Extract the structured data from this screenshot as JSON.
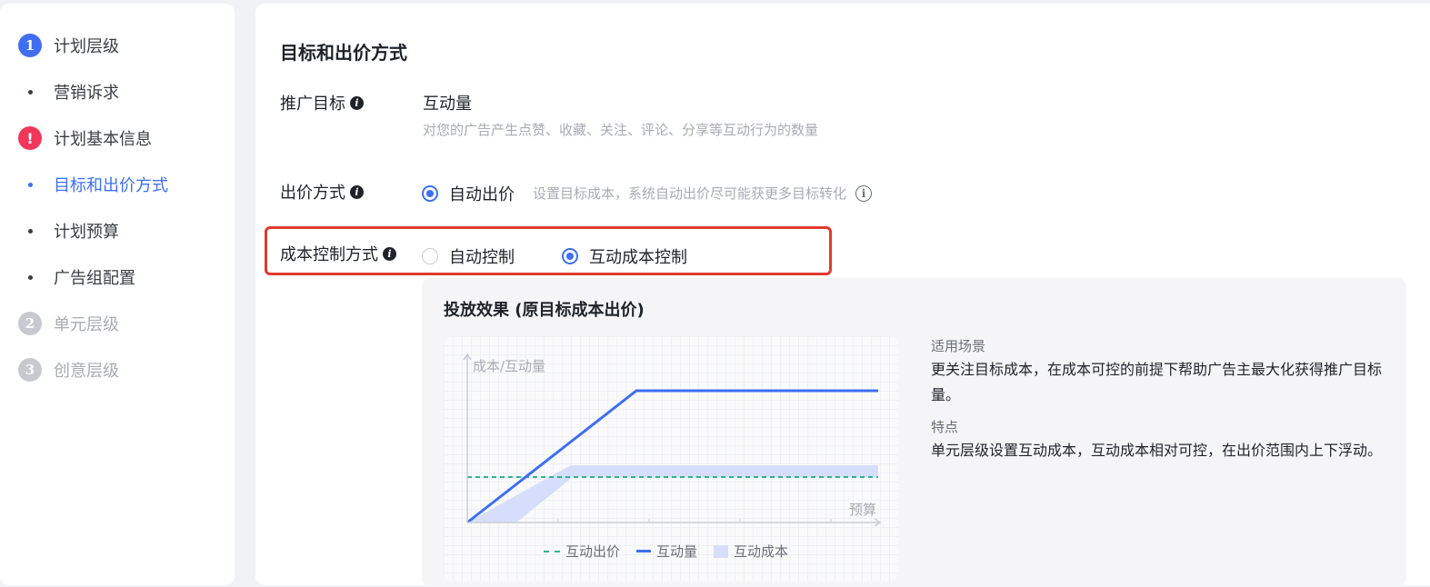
{
  "sidebar": {
    "items": [
      {
        "label": "计划层级",
        "marker": "1",
        "kind": "badge-blue"
      },
      {
        "label": "营销诉求",
        "marker": "",
        "kind": "dot"
      },
      {
        "label": "计划基本信息",
        "marker": "!",
        "kind": "badge-red"
      },
      {
        "label": "目标和出价方式",
        "marker": "",
        "kind": "dot-active"
      },
      {
        "label": "计划预算",
        "marker": "",
        "kind": "dot"
      },
      {
        "label": "广告组配置",
        "marker": "",
        "kind": "dot"
      },
      {
        "label": "单元层级",
        "marker": "2",
        "kind": "badge-grey"
      },
      {
        "label": "创意层级",
        "marker": "3",
        "kind": "badge-grey"
      }
    ]
  },
  "main": {
    "section_title": "目标和出价方式",
    "goal": {
      "label": "推广目标",
      "value": "互动量",
      "description": "对您的广告产生点赞、收藏、关注、评论、分享等互动行为的数量"
    },
    "bid": {
      "label": "出价方式",
      "option": "自动出价",
      "hint": "设置目标成本，系统自动出价尽可能获更多目标转化"
    },
    "cost_control": {
      "label": "成本控制方式",
      "options": [
        {
          "label": "自动控制",
          "checked": false
        },
        {
          "label": "互动成本控制",
          "checked": true
        }
      ]
    }
  },
  "effect": {
    "title": "投放效果 (原目标成本出价)",
    "scenario_head": "适用场景",
    "scenario_body": "更关注目标成本，在成本可控的前提下帮助广告主最大化获得推广目标量。",
    "feature_head": "特点",
    "feature_body": "单元层级设置互动成本，互动成本相对可控，在出价范围内上下浮动。"
  },
  "chart_data": {
    "type": "line",
    "ylabel": "成本/互动量",
    "xlabel": "预算",
    "legend": [
      "互动出价",
      "互动量",
      "互动成本"
    ],
    "series_colors": {
      "互动出价": "#2bb58a",
      "互动量": "#3f6ff0",
      "互动成本": "#d6defc"
    }
  },
  "icons": {
    "info": "info-icon",
    "circle_info": "circle-info-icon"
  }
}
